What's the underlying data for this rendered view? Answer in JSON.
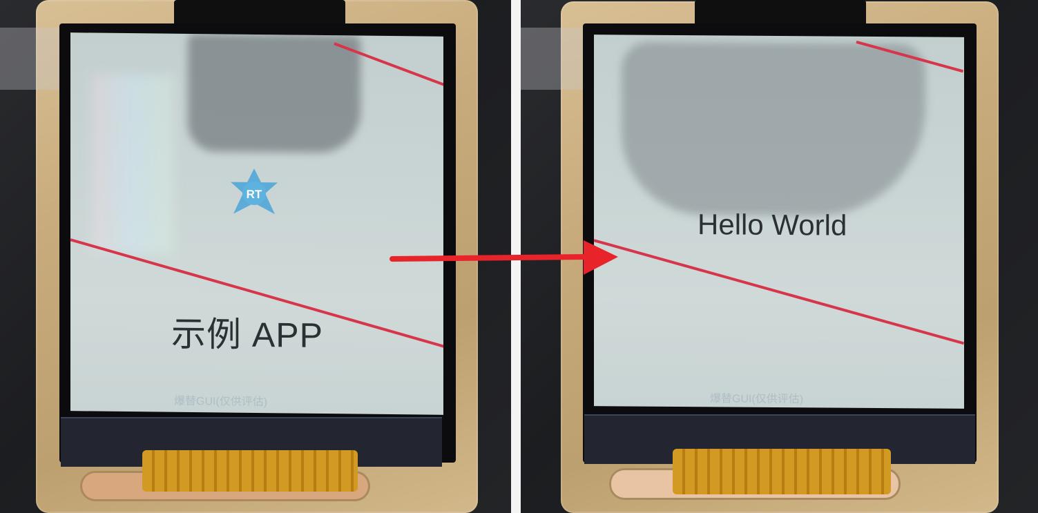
{
  "before_screen": {
    "logo_text": "RT",
    "title": "示例 APP",
    "watermark": "爆替GUI(仅供评估)"
  },
  "after_screen": {
    "title": "Hello World",
    "watermark": "爆替GUI(仅供评估)"
  },
  "colors": {
    "arrow": "#e8232a",
    "red_line": "#d6354a",
    "logo": "#4aa4d8",
    "board_gold": "#c8ab7c",
    "fpc_orange": "#d29a22"
  }
}
